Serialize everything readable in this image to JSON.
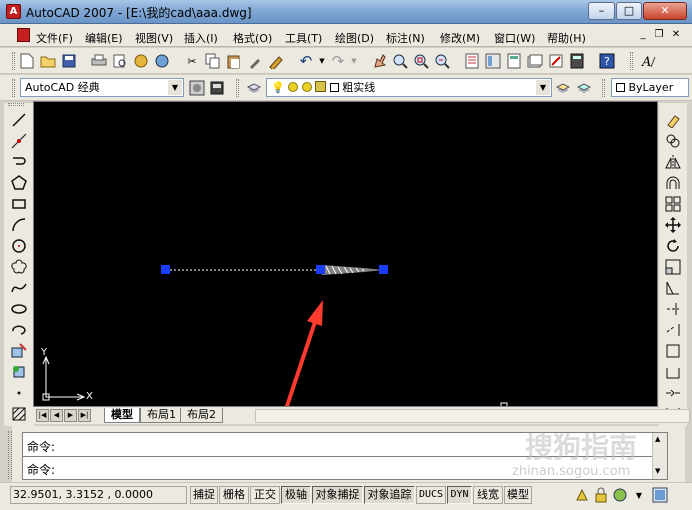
{
  "window": {
    "title": "AutoCAD 2007 - [E:\\我的cad\\aaa.dwg]"
  },
  "menu": [
    "文件(F)",
    "编辑(E)",
    "视图(V)",
    "插入(I)",
    "格式(O)",
    "工具(T)",
    "绘图(D)",
    "标注(N)",
    "修改(M)",
    "窗口(W)",
    "帮助(H)"
  ],
  "workspace": {
    "value": "AutoCAD 经典"
  },
  "layer": {
    "value": "粗实线"
  },
  "color_control": {
    "value": "ByLayer"
  },
  "layout_tabs": [
    "模型",
    "布局1",
    "布局2"
  ],
  "ucs": {
    "y_label": "Y",
    "x_label": "X"
  },
  "command": {
    "line1": "命令:",
    "line2": "命令:"
  },
  "status": {
    "coords": "32.9501, 3.3152 , 0.0000",
    "toggles": [
      "捕捉",
      "栅格",
      "正交",
      "极轴",
      "对象捕捉",
      "对象追踪",
      "DUCS",
      "DYN",
      "线宽",
      "模型"
    ]
  },
  "watermark": {
    "main": "搜狗指南",
    "sub": "zhinan.sogou.com"
  },
  "colors": {
    "canvas": "#000000",
    "grip": "#1a3cff",
    "arrow": "#ff3b30"
  }
}
